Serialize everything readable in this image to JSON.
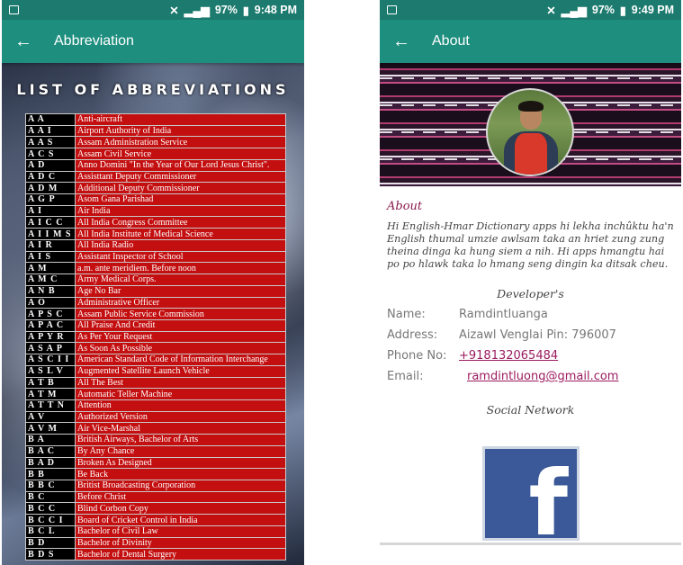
{
  "left": {
    "status": {
      "time": "9:48 PM",
      "battery": "97%"
    },
    "appbar": {
      "back": "←",
      "title": "Abbreviation"
    },
    "heading": "LIST OF ABBREVIATIONS",
    "rows": [
      {
        "code": "A A",
        "meaning": "Anti-aircraft"
      },
      {
        "code": "A A I",
        "meaning": "Airport Authority of India"
      },
      {
        "code": "A A S",
        "meaning": "Assam Administration Service"
      },
      {
        "code": "A C S",
        "meaning": "Assam Civil Service"
      },
      {
        "code": "A D",
        "meaning": "Anno Domini \"In the Year of Our Lord Jesus Christ\"."
      },
      {
        "code": "A D C",
        "meaning": "Assisttant Deputy Commissioner"
      },
      {
        "code": "A D M",
        "meaning": "Additional Deputy Commissioner"
      },
      {
        "code": "A G P",
        "meaning": "Asom Gana Parishad"
      },
      {
        "code": "A I",
        "meaning": "Air India"
      },
      {
        "code": "A I C C",
        "meaning": "All India Congress Committee"
      },
      {
        "code": "A I I M S",
        "meaning": "All India Institute of Medical Science"
      },
      {
        "code": "A I R",
        "meaning": "All India Radio"
      },
      {
        "code": "A I S",
        "meaning": "Assistant Inspector of School"
      },
      {
        "code": "A M",
        "meaning": "a.m. ante meridiem. Before noon"
      },
      {
        "code": "A M C",
        "meaning": "Army Medical Corps."
      },
      {
        "code": "A N B",
        "meaning": "Age No Bar"
      },
      {
        "code": "A O",
        "meaning": "Administrative Officer"
      },
      {
        "code": "A P S C",
        "meaning": "Assam Public Service Commission"
      },
      {
        "code": "A P A C",
        "meaning": "All Praise And Credit"
      },
      {
        "code": "A P Y R",
        "meaning": "As Per Your Request"
      },
      {
        "code": "A S A P",
        "meaning": "As Soon As Possible"
      },
      {
        "code": "A S C I I",
        "meaning": "American Standard Code of Information Interchange"
      },
      {
        "code": "A S L V",
        "meaning": "Augmented Satellite Launch Vehicle"
      },
      {
        "code": "A T B",
        "meaning": "All The Best"
      },
      {
        "code": "A T M",
        "meaning": "Automatic Teller Machine"
      },
      {
        "code": "A T T N",
        "meaning": "Attention"
      },
      {
        "code": "A V",
        "meaning": "Authorized Version"
      },
      {
        "code": "A V M",
        "meaning": "Air Vice-Marshal"
      },
      {
        "code": "B A",
        "meaning": "British Airways, Bachelor of Arts"
      },
      {
        "code": "B A C",
        "meaning": "By Any Chance"
      },
      {
        "code": "B A D",
        "meaning": "Broken As Designed"
      },
      {
        "code": "B B",
        "meaning": "Be Back"
      },
      {
        "code": "B B C",
        "meaning": "Britist Broadcasting Corporation"
      },
      {
        "code": "B C",
        "meaning": "Before Christ"
      },
      {
        "code": "B C C",
        "meaning": "Blind Corbon Copy"
      },
      {
        "code": "B C C I",
        "meaning": "Board of Cricket Control in India"
      },
      {
        "code": "B C L",
        "meaning": "Bachelor of Civil Law"
      },
      {
        "code": "B D",
        "meaning": "Bachelor of Divinity"
      },
      {
        "code": "B D S",
        "meaning": "Bachelor of Dental Surgery"
      }
    ]
  },
  "right": {
    "status": {
      "time": "9:49 PM",
      "battery": "97%"
    },
    "appbar": {
      "back": "←",
      "title": "About"
    },
    "about_title": "About",
    "about_text": "Hi English-Hmar Dictionary apps hi lekha inchûktu ha'n English thumal umzie awlsam taka an hriet zung zung theina dinga ka hung siem a nih. Hi apps hmangtu hai po po hlawk taka lo hmang seng dingin ka ditsak cheu.",
    "developer_title": "Developer's",
    "name_label": "Name:",
    "name_value": "Ramdintluanga",
    "address_label": "Address:",
    "address_value": "Aizawl Venglai Pin: 796007",
    "phone_label": "Phone No:",
    "phone_value": "+918132065484",
    "email_label": "Email:",
    "email_value": "ramdintluong@gmail.com",
    "social_title": "Social Network",
    "facebook_letter": "f"
  }
}
